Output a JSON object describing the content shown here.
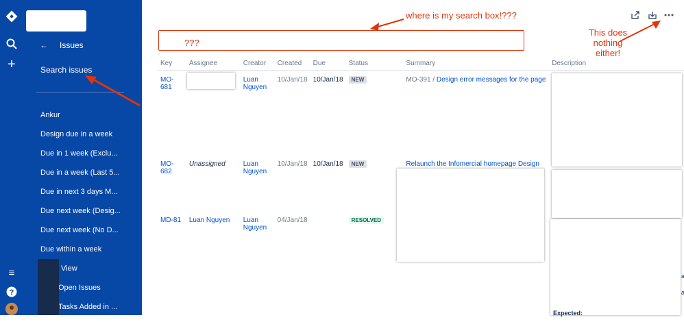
{
  "sidebar": {
    "back_icon": "←",
    "back_label": "Issues",
    "search_link": "Search issues",
    "filters": [
      "Ankur",
      "Design due in a week",
      "Due in 1 week (Exclu...",
      "Due in a week (Last 5...",
      "Due in next 3 days M...",
      "Due next week (Desig...",
      "Due next week (No D...",
      "Due within a week",
      "View",
      "Open Issues",
      "Tasks Added in ..."
    ]
  },
  "rail": {
    "icons": [
      "logo-icon",
      "search-icon",
      "plus-icon",
      "menu-icon",
      "help-icon",
      "avatar"
    ]
  },
  "search": {
    "placeholder": "???"
  },
  "annotations": {
    "search": "where is my search box!???",
    "more": "This does\nnothing\neither!"
  },
  "table": {
    "headers": [
      "Key",
      "Assignee",
      "Creator",
      "Created",
      "Due",
      "Status",
      "Summary",
      "Description"
    ],
    "rows": [
      {
        "key": "MO-681",
        "assignee": "",
        "creator": "Luan\nNguyen",
        "created": "10/Jan/18",
        "due": "10/Jan/18",
        "status": "NEW",
        "summary_parent": "MO-391 /",
        "summary": "Design error messages for the page"
      },
      {
        "key": "MO-682",
        "assignee": "Unassigned",
        "creator": "Luan\nNguyen",
        "created": "10/Jan/18",
        "due": "10/Jan/18",
        "status": "NEW",
        "summary_parent": "",
        "summary": "Relaunch the Infomercial homepage Design to"
      },
      {
        "key": "MD-81",
        "assignee": "Luan Nguyen",
        "creator": "Luan\nNguyen",
        "created": "04/Jan/18",
        "due": "",
        "status": "RESOLVED",
        "summary_parent": "",
        "summary": ""
      }
    ]
  },
  "description_fragments": [
    "a",
    "a",
    "Expected:"
  ],
  "colors": {
    "nav": "#0747a6",
    "link": "#0052cc",
    "annotation": "#de350b"
  }
}
